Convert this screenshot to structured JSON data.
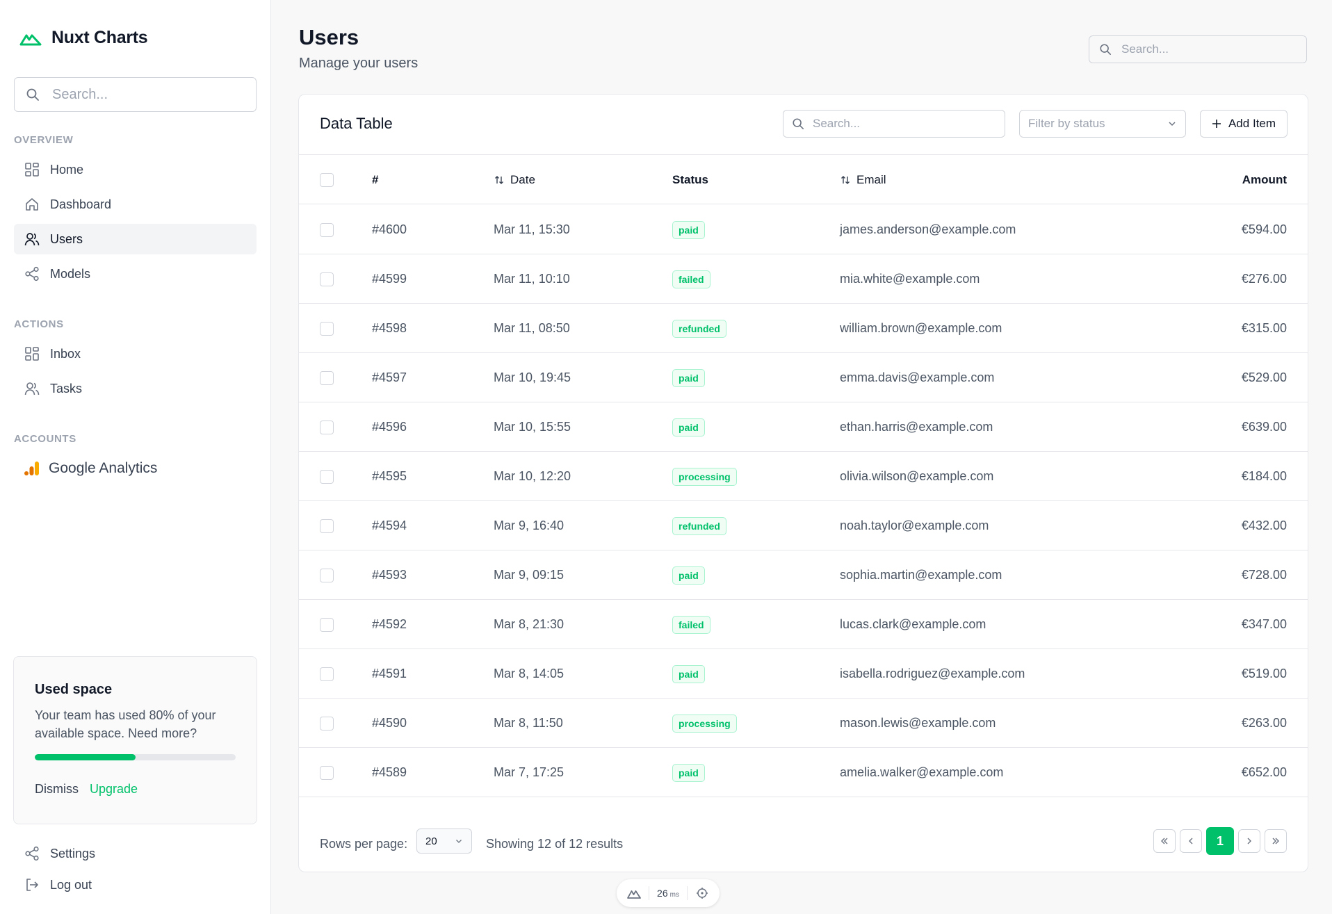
{
  "app": {
    "brand_name": "Nuxt Charts",
    "search_placeholder": "Search..."
  },
  "sidebar": {
    "sections": [
      {
        "label": "OVERVIEW"
      },
      {
        "label": "ACTIONS"
      },
      {
        "label": "ACCOUNTS"
      }
    ],
    "overview_items": [
      {
        "label": "Home",
        "icon": "grid-icon"
      },
      {
        "label": "Dashboard",
        "icon": "home-icon"
      },
      {
        "label": "Users",
        "icon": "users-icon",
        "active": true
      },
      {
        "label": "Models",
        "icon": "share-icon"
      }
    ],
    "action_items": [
      {
        "label": "Inbox",
        "icon": "grid-icon"
      },
      {
        "label": "Tasks",
        "icon": "users-icon"
      }
    ],
    "accounts": [
      {
        "label": "Google Analytics",
        "icon": "google-analytics-icon"
      }
    ],
    "used_space": {
      "title": "Used space",
      "description": "Your team has used 80% of your available space. Need more?",
      "progress_fraction": 0.5,
      "dismiss_label": "Dismiss",
      "upgrade_label": "Upgrade"
    },
    "bottom_items": [
      {
        "label": "Settings",
        "icon": "share-icon"
      },
      {
        "label": "Log out",
        "icon": "logout-icon"
      }
    ]
  },
  "header": {
    "title": "Users",
    "subtitle": "Manage your users",
    "search_placeholder": "Search..."
  },
  "table_card": {
    "title": "Data Table",
    "search_placeholder": "Search...",
    "filter_placeholder": "Filter by status",
    "add_label": "Add Item",
    "columns": {
      "id": "#",
      "date": "Date",
      "status": "Status",
      "email": "Email",
      "amount": "Amount"
    },
    "rows": [
      {
        "id": "#4600",
        "date": "Mar 11, 15:30",
        "status": "paid",
        "email": "james.anderson@example.com",
        "amount": "€594.00"
      },
      {
        "id": "#4599",
        "date": "Mar 11, 10:10",
        "status": "failed",
        "email": "mia.white@example.com",
        "amount": "€276.00"
      },
      {
        "id": "#4598",
        "date": "Mar 11, 08:50",
        "status": "refunded",
        "email": "william.brown@example.com",
        "amount": "€315.00"
      },
      {
        "id": "#4597",
        "date": "Mar 10, 19:45",
        "status": "paid",
        "email": "emma.davis@example.com",
        "amount": "€529.00"
      },
      {
        "id": "#4596",
        "date": "Mar 10, 15:55",
        "status": "paid",
        "email": "ethan.harris@example.com",
        "amount": "€639.00"
      },
      {
        "id": "#4595",
        "date": "Mar 10, 12:20",
        "status": "processing",
        "email": "olivia.wilson@example.com",
        "amount": "€184.00"
      },
      {
        "id": "#4594",
        "date": "Mar 9, 16:40",
        "status": "refunded",
        "email": "noah.taylor@example.com",
        "amount": "€432.00"
      },
      {
        "id": "#4593",
        "date": "Mar 9, 09:15",
        "status": "paid",
        "email": "sophia.martin@example.com",
        "amount": "€728.00"
      },
      {
        "id": "#4592",
        "date": "Mar 8, 21:30",
        "status": "failed",
        "email": "lucas.clark@example.com",
        "amount": "€347.00"
      },
      {
        "id": "#4591",
        "date": "Mar 8, 14:05",
        "status": "paid",
        "email": "isabella.rodriguez@example.com",
        "amount": "€519.00"
      },
      {
        "id": "#4590",
        "date": "Mar 8, 11:50",
        "status": "processing",
        "email": "mason.lewis@example.com",
        "amount": "€263.00"
      },
      {
        "id": "#4589",
        "date": "Mar 7, 17:25",
        "status": "paid",
        "email": "amelia.walker@example.com",
        "amount": "€652.00"
      }
    ],
    "footer": {
      "rows_per_page_label": "Rows per page:",
      "rows_per_page_value": "20",
      "showing_text": "Showing 12 of 12 results",
      "current_page": "1"
    }
  },
  "devtools": {
    "value": "26",
    "unit": "ms"
  },
  "colors": {
    "accent": "#00c16a",
    "badge_bg": "#effdf5",
    "border": "#e5e7eb"
  }
}
